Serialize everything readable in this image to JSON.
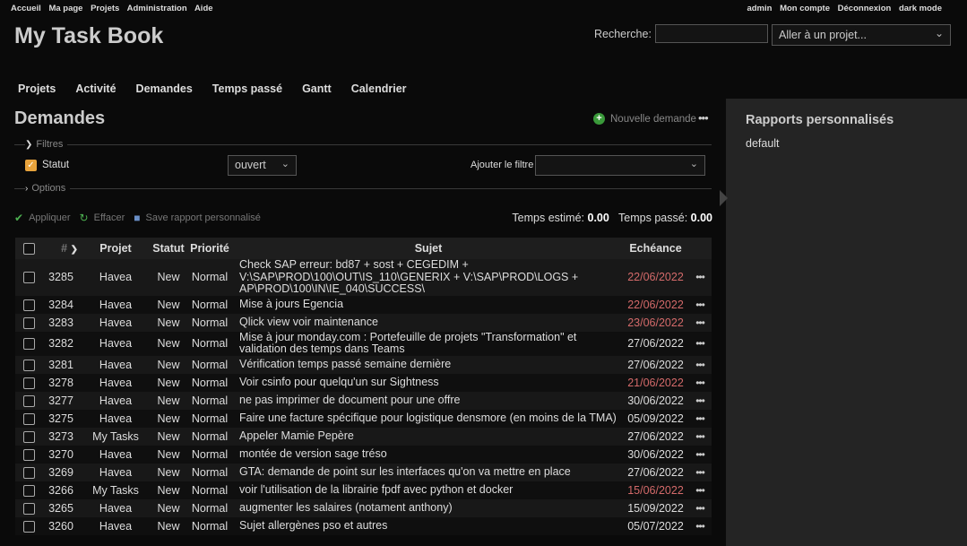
{
  "top_menu": {
    "left": [
      "Accueil",
      "Ma page",
      "Projets",
      "Administration",
      "Aide"
    ],
    "right": [
      "admin",
      "Mon compte",
      "Déconnexion",
      "dark mode"
    ]
  },
  "header": {
    "title": "My Task Book",
    "search_label": "Recherche:",
    "search_value": "",
    "project_jump": "Aller à un projet..."
  },
  "main_menu": [
    "Projets",
    "Activité",
    "Demandes",
    "Temps passé",
    "Gantt",
    "Calendrier"
  ],
  "page": {
    "heading": "Demandes",
    "new_issue": "Nouvelle demande",
    "more": "•••"
  },
  "filters": {
    "legend": "Filtres",
    "statut_label": "Statut",
    "statut_checked": true,
    "statut_operator": "ouvert",
    "add_filter_label": "Ajouter le filtre",
    "options_legend": "Options"
  },
  "actions": {
    "apply": "Appliquer",
    "clear": "Effacer",
    "save": "Save rapport personnalisé"
  },
  "totals": {
    "estimated_label": "Temps estimé:",
    "estimated_value": "0.00",
    "spent_label": "Temps passé:",
    "spent_value": "0.00"
  },
  "table": {
    "columns": [
      "#",
      "Projet",
      "Statut",
      "Priorité",
      "Sujet",
      "Echéance"
    ],
    "rows": [
      {
        "id": "3285",
        "project": "Havea",
        "status": "New",
        "priority": "Normal",
        "subject": "Check SAP erreur: bd87 + sost + CEGEDIM + V:\\SAP\\PROD\\100\\OUT\\IS_110\\GENERIX + V:\\SAP\\PROD\\LOGS + AP\\PROD\\100\\IN\\IE_040\\SUCCESS\\",
        "due": "22/06/2022",
        "overdue": true
      },
      {
        "id": "3284",
        "project": "Havea",
        "status": "New",
        "priority": "Normal",
        "subject": "Mise à jours Egencia",
        "due": "22/06/2022",
        "overdue": true
      },
      {
        "id": "3283",
        "project": "Havea",
        "status": "New",
        "priority": "Normal",
        "subject": "Qlick view voir maintenance",
        "due": "23/06/2022",
        "overdue": true
      },
      {
        "id": "3282",
        "project": "Havea",
        "status": "New",
        "priority": "Normal",
        "subject": "Mise à jour monday.com : Portefeuille de projets \"Transformation\" et validation des temps dans Teams",
        "due": "27/06/2022",
        "overdue": false
      },
      {
        "id": "3281",
        "project": "Havea",
        "status": "New",
        "priority": "Normal",
        "subject": "Vérification temps passé semaine dernière",
        "due": "27/06/2022",
        "overdue": false
      },
      {
        "id": "3278",
        "project": "Havea",
        "status": "New",
        "priority": "Normal",
        "subject": "Voir csinfo pour quelqu'un sur Sightness",
        "due": "21/06/2022",
        "overdue": true
      },
      {
        "id": "3277",
        "project": "Havea",
        "status": "New",
        "priority": "Normal",
        "subject": "ne pas imprimer de document pour une offre",
        "due": "30/06/2022",
        "overdue": false
      },
      {
        "id": "3275",
        "project": "Havea",
        "status": "New",
        "priority": "Normal",
        "subject": "Faire une facture spécifique pour logistique densmore (en moins de la TMA)",
        "due": "05/09/2022",
        "overdue": false
      },
      {
        "id": "3273",
        "project": "My Tasks",
        "status": "New",
        "priority": "Normal",
        "subject": "Appeler Mamie Pepère",
        "due": "27/06/2022",
        "overdue": false
      },
      {
        "id": "3270",
        "project": "Havea",
        "status": "New",
        "priority": "Normal",
        "subject": "montée de version sage tréso",
        "due": "30/06/2022",
        "overdue": false
      },
      {
        "id": "3269",
        "project": "Havea",
        "status": "New",
        "priority": "Normal",
        "subject": "GTA: demande de point sur les interfaces qu'on va mettre en place",
        "due": "27/06/2022",
        "overdue": false
      },
      {
        "id": "3266",
        "project": "My Tasks",
        "status": "New",
        "priority": "Normal",
        "subject": "voir l'utilisation de la librairie fpdf avec python et docker",
        "due": "15/06/2022",
        "overdue": true
      },
      {
        "id": "3265",
        "project": "Havea",
        "status": "New",
        "priority": "Normal",
        "subject": "augmenter les salaires (notament anthony)",
        "due": "15/09/2022",
        "overdue": false
      },
      {
        "id": "3260",
        "project": "Havea",
        "status": "New",
        "priority": "Normal",
        "subject": "Sujet allergènes pso et autres",
        "due": "05/07/2022",
        "overdue": false
      }
    ]
  },
  "sidebar": {
    "title": "Rapports personnalisés",
    "items": [
      "default"
    ]
  },
  "colors": {
    "overdue": "#d46a6a",
    "checkbox_checked": "#e8a33c",
    "new_issue_icon": "#3a9a3a"
  }
}
